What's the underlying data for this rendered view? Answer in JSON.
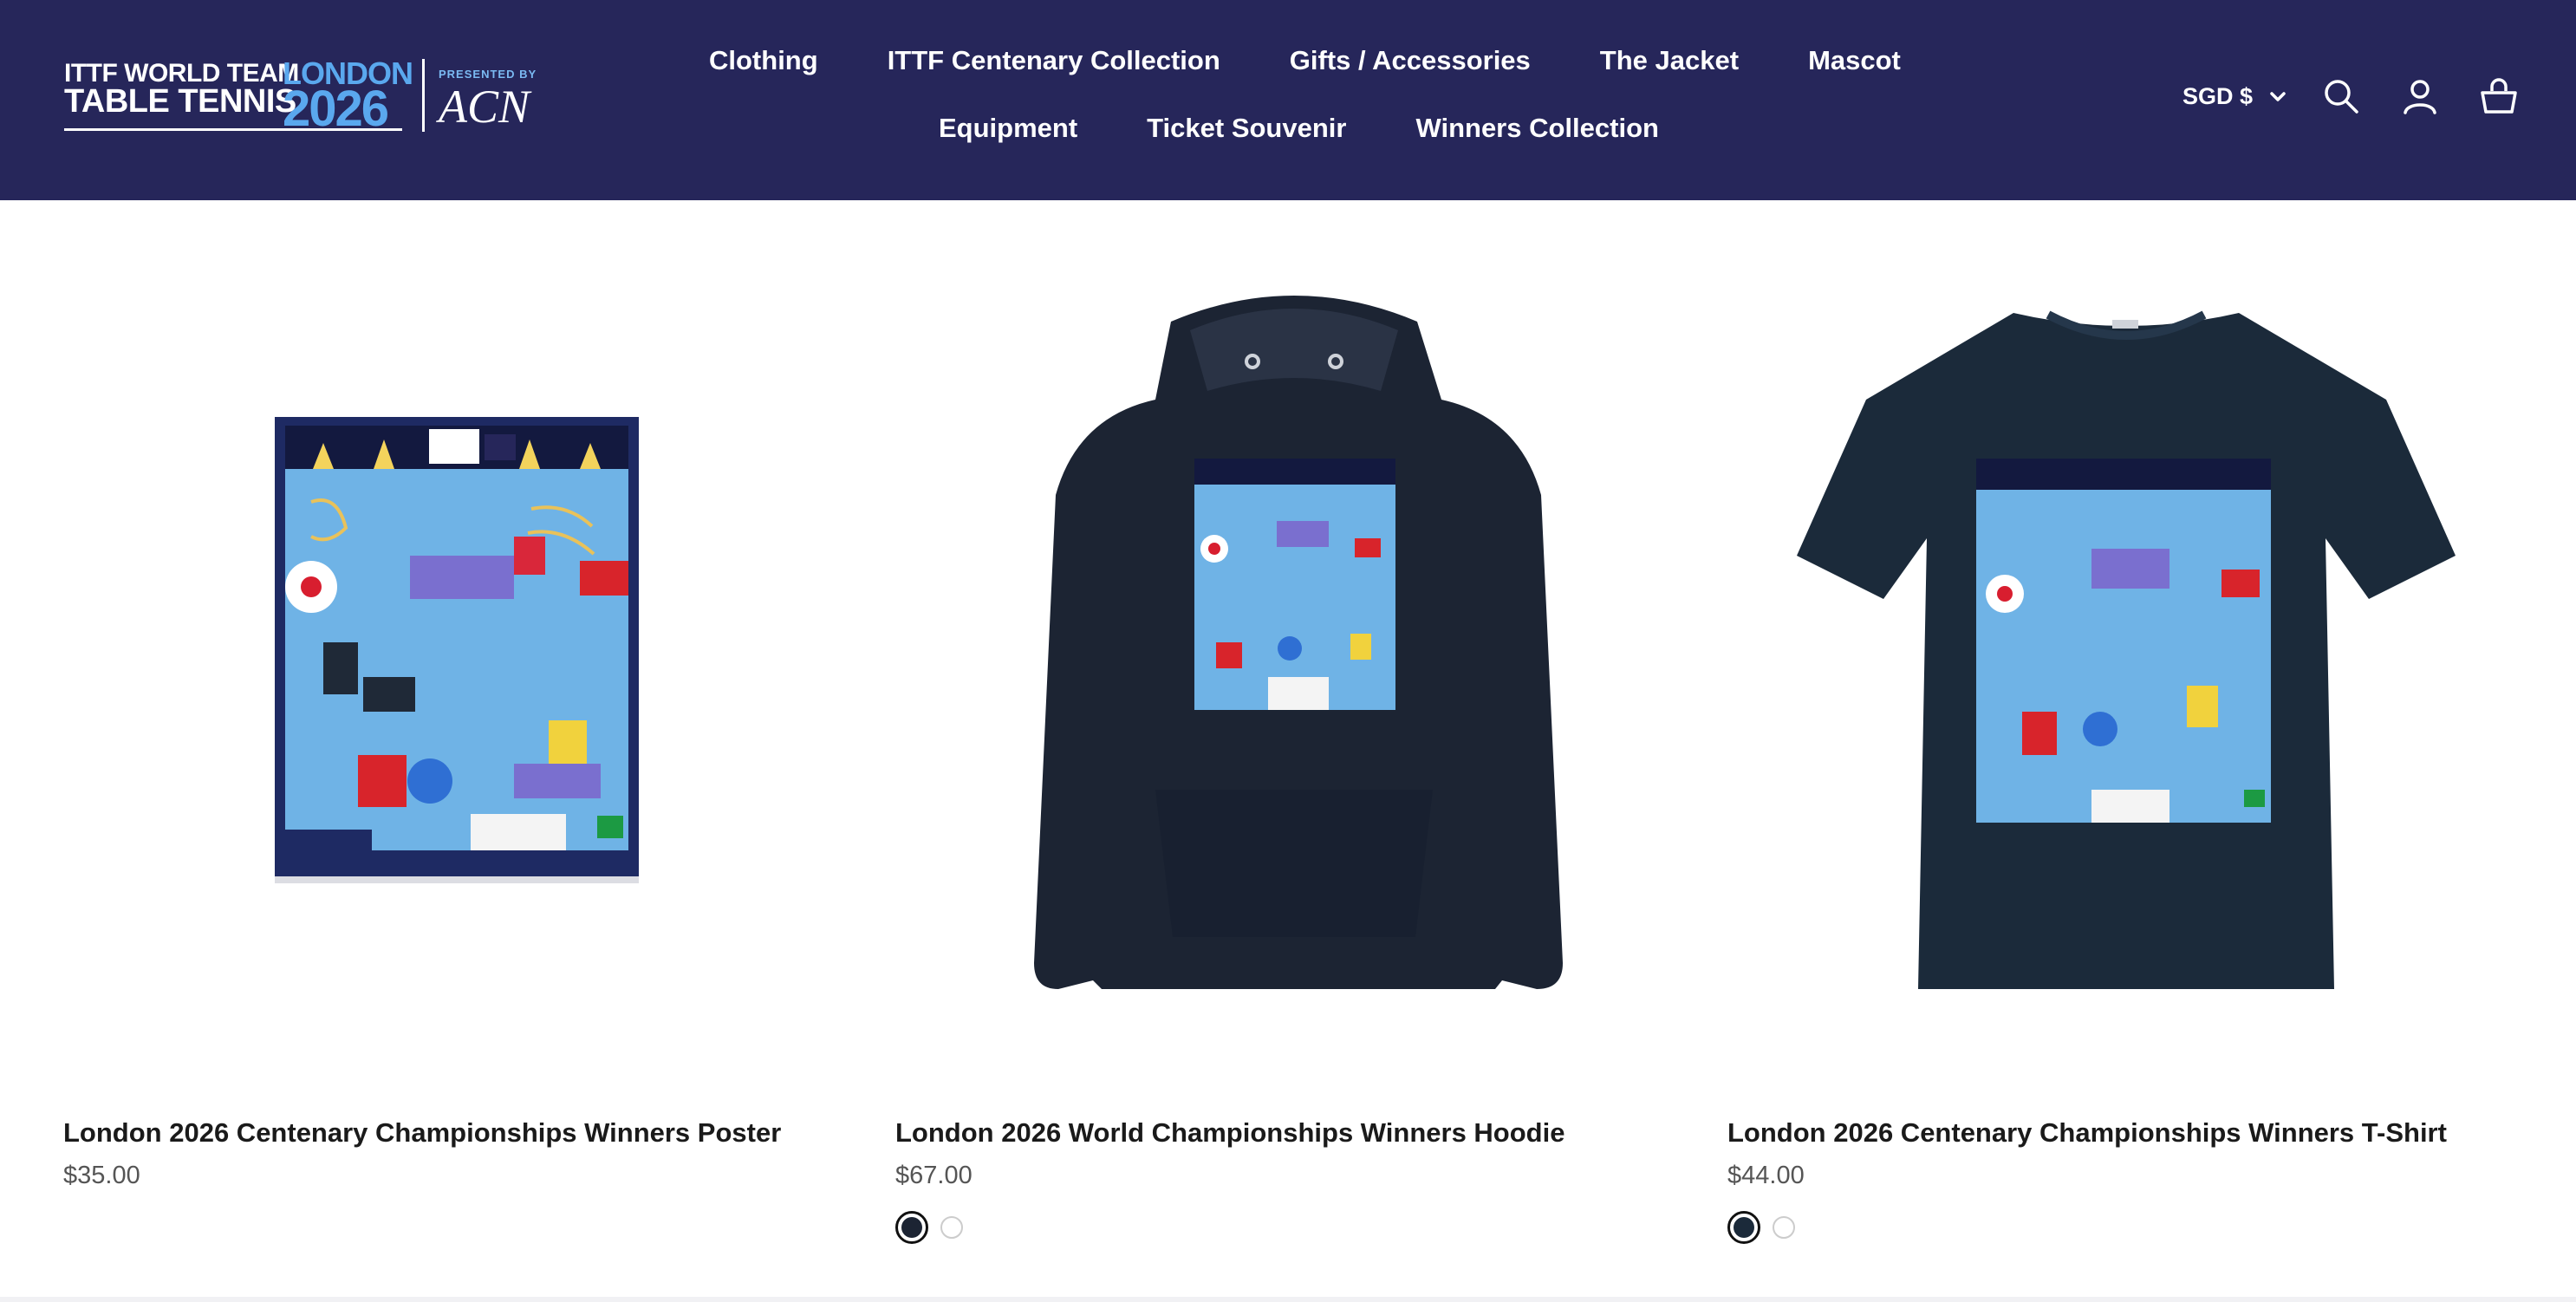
{
  "header": {
    "logo": {
      "line1": "ITTF WORLD TEAM",
      "line2": "TABLE TENNIS",
      "city": "LONDON",
      "year": "2026",
      "presented_by": "PRESENTED BY",
      "sponsor": "ACN"
    },
    "nav_row1": [
      "Clothing",
      "ITTF Centenary Collection",
      "Gifts / Accessories",
      "The Jacket",
      "Mascot"
    ],
    "nav_row2": [
      "Equipment",
      "Ticket Souvenir",
      "Winners Collection"
    ],
    "currency": "SGD $",
    "icons": [
      "search-icon",
      "account-icon",
      "cart-icon"
    ]
  },
  "products": [
    {
      "title": "London 2026 Centenary Championships Winners Poster",
      "price": "$35.00",
      "swatches": []
    },
    {
      "title": "London 2026 World Championships Winners Hoodie",
      "price": "$67.00",
      "swatches": [
        "#1c2433",
        "#ffffff"
      ]
    },
    {
      "title": "London 2026 Centenary Championships Winners T-Shirt",
      "price": "$44.00",
      "swatches": [
        "#1b2a3a",
        "#ffffff"
      ]
    }
  ],
  "colors": {
    "header_bg": "#26265a",
    "accent_blue": "#5aa8ee",
    "artwork_blue": "#6fb3e6",
    "hoodie": "#1c2433",
    "tshirt": "#1b2a3a"
  }
}
